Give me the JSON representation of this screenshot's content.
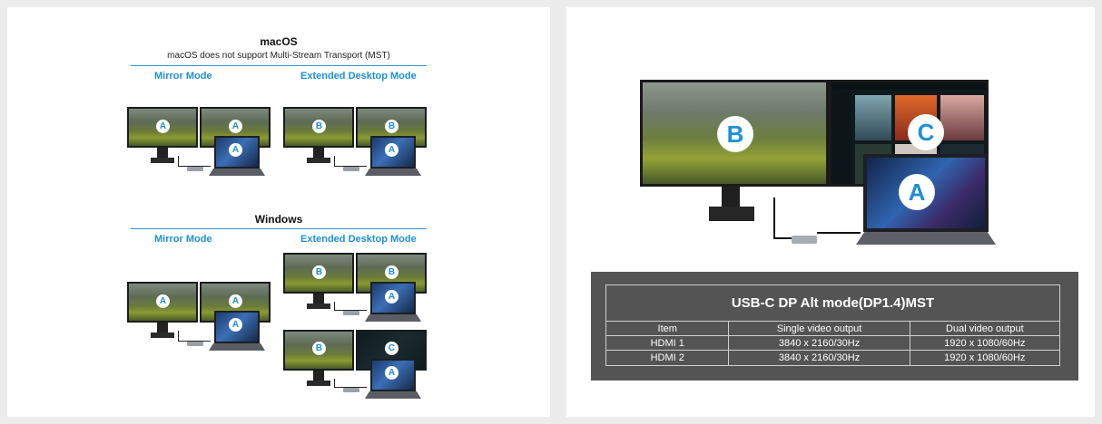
{
  "macos": {
    "title": "macOS",
    "subtitle": "macOS does not support Multi-Stream Transport (MST)",
    "mirror_label": "Mirror Mode",
    "extended_label": "Extended Desktop Mode"
  },
  "windows": {
    "title": "Windows",
    "mirror_label": "Mirror Mode",
    "extended_label": "Extended Desktop Mode"
  },
  "badges": {
    "a": "A",
    "b": "B",
    "c": "C"
  },
  "table": {
    "title": "USB-C DP Alt mode(DP1.4)MST",
    "headers": [
      "Item",
      "Single video output",
      "Dual video output"
    ],
    "rows": [
      [
        "HDMI 1",
        "3840 x 2160/30Hz",
        "1920 x 1080/60Hz"
      ],
      [
        "HDMI 2",
        "3840 x 2160/30Hz",
        "1920 x 1080/60Hz"
      ]
    ]
  },
  "colors": {
    "accent": "#1f8fd8",
    "table_bg": "#545454"
  }
}
